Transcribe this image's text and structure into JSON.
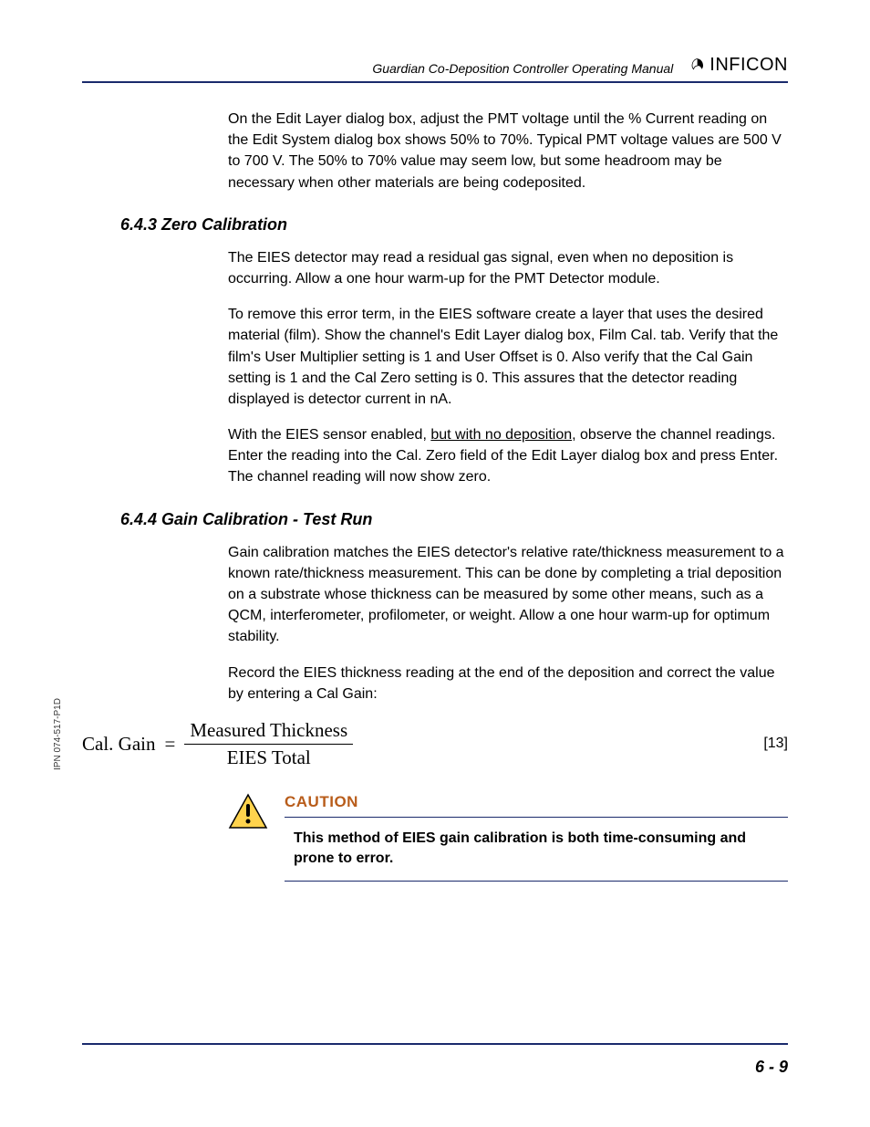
{
  "header": {
    "manual_title": "Guardian Co-Deposition Controller Operating Manual",
    "logo_text": "INFICON"
  },
  "intro_para": "On the Edit Layer dialog box, adjust the PMT voltage until the % Current reading on the Edit System dialog box shows 50% to 70%. Typical PMT voltage values are 500 V to 700 V. The 50% to 70% value may seem low, but some headroom may be necessary when other materials are being codeposited.",
  "section_643": {
    "heading": "6.4.3  Zero Calibration",
    "p1": "The EIES detector may read a residual gas signal, even when no deposition is occurring. Allow a one hour warm-up for the PMT Detector module.",
    "p2": "To remove this error term, in the EIES software create a layer that uses the desired material (film). Show the channel's Edit Layer dialog box, Film Cal. tab. Verify that the film's User Multiplier setting is 1 and User Offset is 0. Also verify that the Cal Gain setting is 1 and the Cal Zero setting is 0. This assures that the detector reading displayed is detector current in nA.",
    "p3a": "With the EIES sensor enabled, ",
    "p3u": "but with no deposition",
    "p3b": ", observe the channel readings. Enter the reading into the Cal. Zero field of the Edit Layer dialog box and press Enter. The channel reading will now show zero."
  },
  "section_644": {
    "heading": "6.4.4  Gain Calibration - Test Run",
    "p1": "Gain calibration matches the EIES detector's relative rate/thickness measurement to a known rate/thickness measurement. This can be done by completing a trial deposition on a substrate whose thickness can be measured by some other means, such as a QCM, interferometer, profilometer, or weight. Allow a one hour warm-up for optimum stability.",
    "p2": "Record the EIES thickness reading at the end of the deposition and correct the value by entering a Cal Gain:",
    "eq_lhs": "Cal. Gain",
    "eq_eq": "=",
    "eq_num": "Measured Thickness",
    "eq_den": "EIES Total",
    "eq_tag": "[13]"
  },
  "caution": {
    "title": "CAUTION",
    "text": "This method of EIES gain calibration is both time-consuming and prone to error."
  },
  "footer": {
    "page_number": "6 - 9",
    "side_label": "IPN 074-517-P1D"
  }
}
